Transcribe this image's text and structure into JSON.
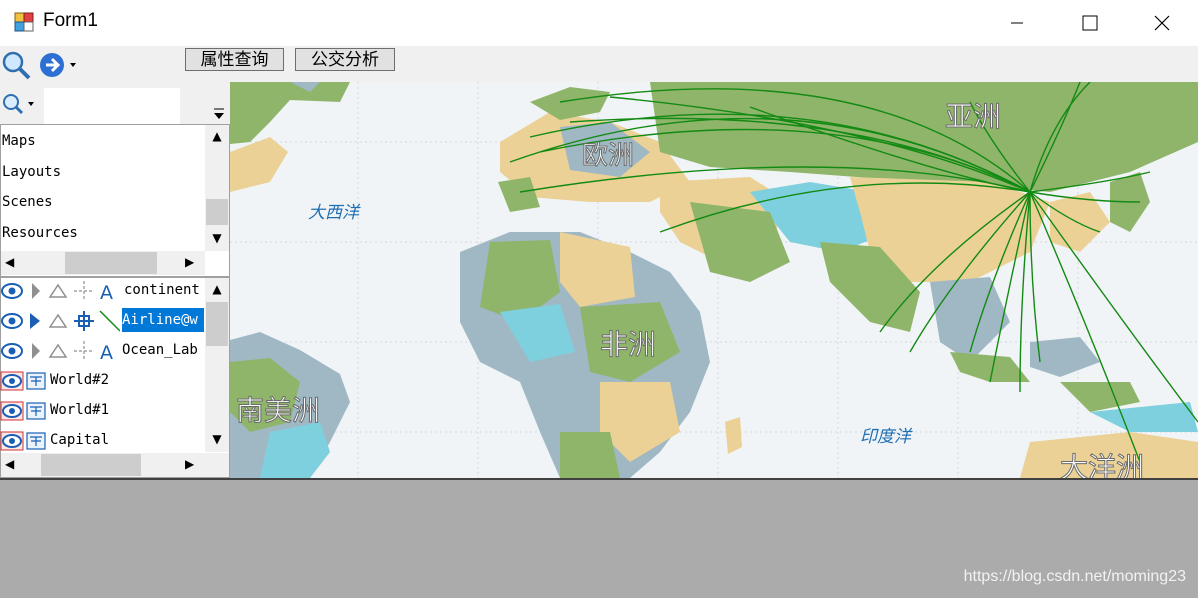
{
  "window": {
    "title": "Form1",
    "controls": {
      "minimize": "—",
      "maximize": "☐",
      "close": "✕"
    }
  },
  "toolbar": {
    "buttons": [
      {
        "label": "属性查询"
      },
      {
        "label": "公交分析"
      }
    ]
  },
  "left_panel": {
    "search_placeholder": "",
    "workspace_tree": [
      "Maps",
      "Layouts",
      "Scenes",
      "Resources"
    ],
    "layers": [
      {
        "label": "continent",
        "selected": false
      },
      {
        "label": "Airline@w",
        "selected": true
      },
      {
        "label": "Ocean_Lab",
        "selected": false
      },
      {
        "label": "World#2",
        "selected": false
      },
      {
        "label": "World#1",
        "selected": false
      },
      {
        "label": "Capital",
        "selected": false
      }
    ]
  },
  "map": {
    "labels": {
      "asia": "亚洲",
      "europe": "欧洲",
      "africa": "非洲",
      "south_america": "南美洲",
      "oceania": "大洋洲",
      "atlantic": "大西洋",
      "indian_ocean": "印度洋"
    },
    "colors": {
      "ocean": "#f1f4f7",
      "land_green": "#8fb56a",
      "land_tan": "#ebd195",
      "land_cyan": "#7fd0de",
      "land_gray": "#9fb8c4",
      "airline": "#138a13"
    }
  },
  "watermark": "https://blog.csdn.net/moming23"
}
